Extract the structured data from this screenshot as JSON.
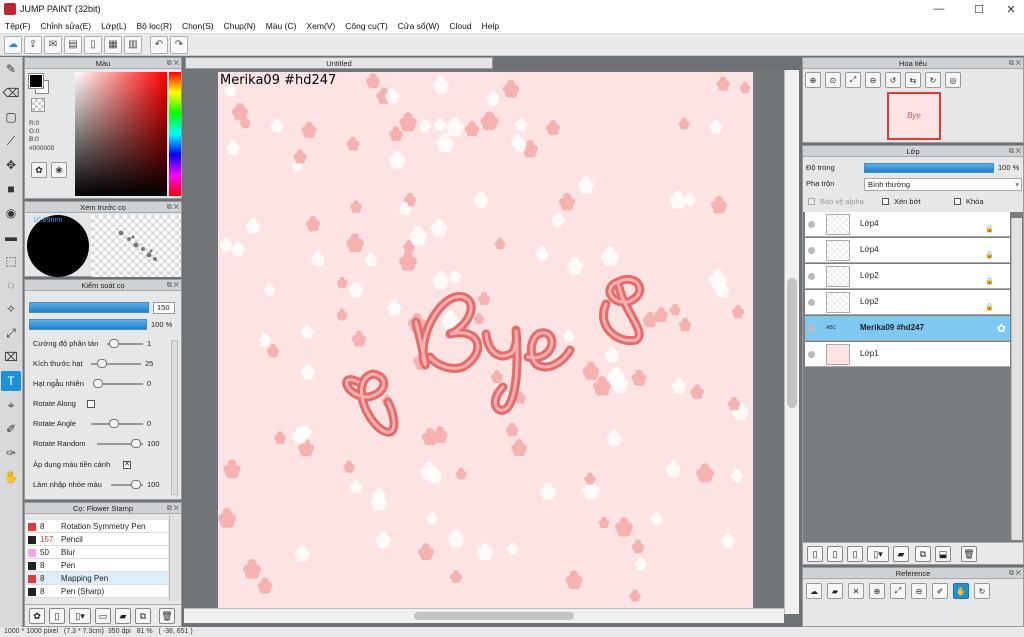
{
  "window": {
    "title": "JUMP PAINT (32bit)",
    "minimize": "—",
    "maximize": "☐",
    "close": "✕"
  },
  "menu": [
    "Tệp(F)",
    "Chỉnh sửa(E)",
    "Lớp(L)",
    "Bộ lọc(R)",
    "Chọn(S)",
    "Chụp(N)",
    "Màu (C)",
    "Xem(V)",
    "Công cụ(T)",
    "Cửa sổ(W)",
    "Cloud",
    "Help"
  ],
  "toolbar": {
    "icons": [
      "cloud-icon",
      "export-icon",
      "comment-icon",
      "panel-icon",
      "document-icon",
      "grid-icon",
      "layout-icon",
      "undo-icon",
      "redo-icon"
    ],
    "undo": "↶",
    "redo": "↷"
  },
  "tools": [
    {
      "name": "brush",
      "glyph": "✎"
    },
    {
      "name": "eraser",
      "glyph": "⌫"
    },
    {
      "name": "rectangle",
      "glyph": "▢"
    },
    {
      "name": "line",
      "glyph": "⟋"
    },
    {
      "name": "move",
      "glyph": "✥"
    },
    {
      "name": "fill",
      "glyph": "■"
    },
    {
      "name": "bucket",
      "glyph": "◉"
    },
    {
      "name": "gradient",
      "glyph": "▬"
    },
    {
      "name": "select-rect",
      "glyph": "⬚"
    },
    {
      "name": "lasso",
      "glyph": "◌"
    },
    {
      "name": "magic-wand",
      "glyph": "✧"
    },
    {
      "name": "select-pen",
      "glyph": "⤢"
    },
    {
      "name": "select-eraser",
      "glyph": "⌧"
    },
    {
      "name": "text",
      "glyph": "T"
    },
    {
      "name": "fill-select",
      "glyph": "⌖"
    },
    {
      "name": "eyedropper",
      "glyph": "✐"
    },
    {
      "name": "pen-tool",
      "glyph": "✑"
    },
    {
      "name": "hand",
      "glyph": "✋"
    }
  ],
  "color_panel": {
    "title": "Màu",
    "r": "R:0",
    "g": "G:0",
    "b": "B:0",
    "hex": "#000000",
    "foreground": "#000000",
    "background": "#ffffff"
  },
  "brush_preview": {
    "title": "Xem trước cọ",
    "size": "10.89mm"
  },
  "control_panel": {
    "title": "Kiểm soát cọ",
    "size_value": "150",
    "opacity_value": "100 %",
    "rows": [
      {
        "label": "Cường độ phân tán",
        "value": "1"
      },
      {
        "label": "Kích thước hạt",
        "value": "25"
      },
      {
        "label": "Hạt ngẫu nhiên",
        "value": "0"
      },
      {
        "label": "Rotate Along",
        "value": ""
      },
      {
        "label": "Rotate Angle",
        "value": "0"
      },
      {
        "label": "Rotate Random",
        "value": "100"
      },
      {
        "label": "Áp dụng màu tiền cảnh",
        "value": ""
      },
      {
        "label": "Làm nhập nhòe màu",
        "value": "100"
      }
    ],
    "apply_fg_check": "✕"
  },
  "brush_list": {
    "title": "Cọ: Flower Stamp",
    "items": [
      {
        "size": "8",
        "name": "Rotation Symmetry Pen",
        "color": "#e03a3a"
      },
      {
        "size": "157",
        "name": "Pencil",
        "color": "#222222"
      },
      {
        "size": "50",
        "name": "Blur",
        "color": "#f4a6e8"
      },
      {
        "size": "8",
        "name": "Pen",
        "color": "#222222"
      },
      {
        "size": "8",
        "name": "Mapping Pen",
        "color": "#e03a3a"
      },
      {
        "size": "8",
        "name": "Pen (Sharp)",
        "color": "#222222"
      }
    ]
  },
  "document": {
    "tab": "Untitled",
    "text": "Merika09  #hd247",
    "paper_color": "#fde3e3"
  },
  "statusbar": "1000 * 1000 pixel   (7.3 * 7.3cm)  350 dpi   81 %   ( -38, 651 )",
  "navigator": {
    "title": "Hoa tiêu",
    "thumb_text": "Bye"
  },
  "layer_panel": {
    "title": "Lớp",
    "opacity_label": "Độ trong",
    "opacity_value": "100 %",
    "blend_label": "Pha trộn",
    "blend_value": "Bình thường",
    "protect_alpha": "Bảo vệ alpha",
    "clipping": "Xén bớt",
    "lock": "Khóa",
    "layers": [
      {
        "name": "Lớp4",
        "selected": false
      },
      {
        "name": "Lớp4",
        "selected": false
      },
      {
        "name": "Lớp2",
        "selected": false
      },
      {
        "name": "Lớp2",
        "selected": false
      },
      {
        "name": "Merika09  #hd247",
        "selected": true
      },
      {
        "name": "Lớp1",
        "selected": false
      }
    ]
  },
  "reference": {
    "title": "Reference"
  }
}
